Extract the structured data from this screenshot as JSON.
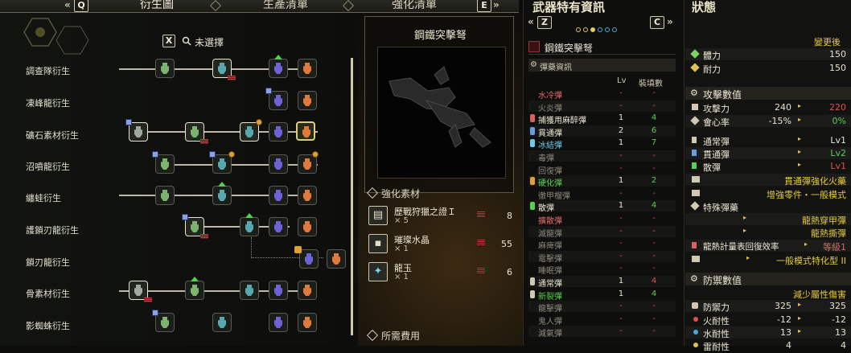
{
  "tabs": {
    "left_key": "Q",
    "right_key": "E",
    "items": [
      "衍生圖",
      "生產清單",
      "強化清單"
    ]
  },
  "filter": {
    "key": "X",
    "label": "未選擇"
  },
  "tree_rows": [
    "調查隊衍生",
    "凍峰龍衍生",
    "礦石素材衍生",
    "沼噴龍衍生",
    "纏蛙衍生",
    "護鎖刃龍衍生",
    "鎖刃龍衍生",
    "骨素材衍生",
    "影蜘蛛衍生"
  ],
  "preview": {
    "weapon_name": "鋼鐵突擊弩"
  },
  "materials": {
    "title": "強化素材",
    "items": [
      {
        "icon": "scroll-icon",
        "name": "歷戰狩獵之證Ｉ",
        "qty": "× 5",
        "owned": "8"
      },
      {
        "icon": "ore-icon",
        "name": "璀璨水晶",
        "qty": "× 1",
        "owned": "55"
      },
      {
        "icon": "gem-icon",
        "name": "龍玉",
        "qty": "× 1",
        "owned": "6"
      }
    ],
    "cost_title": "所需費用"
  },
  "spec": {
    "title": "武器特有資訊",
    "left_key": "Z",
    "right_key": "C",
    "weapon_name": "鋼鐵突擊弩",
    "ammo_header": "彈藥資訊",
    "col_lv": "Lv",
    "col_cap": "裝填數",
    "ammo": [
      {
        "name": "水冷彈",
        "lv": "-",
        "cap": "-",
        "color": "#e06a6a",
        "icon": ""
      },
      {
        "name": "火炎彈",
        "lv": "-",
        "cap": "-",
        "color": "#8c887a",
        "icon": ""
      },
      {
        "name": "捕獲用麻醉彈",
        "lv": "1",
        "cap": "4",
        "color": "#ebe6d2",
        "icon": "#d86060"
      },
      {
        "name": "貫通彈",
        "lv": "2",
        "cap": "6",
        "color": "#ebe6d2",
        "icon": "#6a9ae0"
      },
      {
        "name": "冰結彈",
        "lv": "1",
        "cap": "7",
        "color": "#6fc8e8",
        "icon": "#6fc8e8"
      },
      {
        "name": "毒彈",
        "lv": "-",
        "cap": "-",
        "color": "#8c887a",
        "icon": ""
      },
      {
        "name": "回復彈",
        "lv": "-",
        "cap": "-",
        "color": "#8c887a",
        "icon": ""
      },
      {
        "name": "硬化彈",
        "lv": "1",
        "cap": "2",
        "color": "#58d050",
        "icon": "#e0a032"
      },
      {
        "name": "徹甲榴彈",
        "lv": "-",
        "cap": "-",
        "color": "#8c887a",
        "icon": ""
      },
      {
        "name": "散彈",
        "lv": "1",
        "cap": "4",
        "color": "#ebe6d2",
        "icon": "#58d050"
      },
      {
        "name": "擴散彈",
        "lv": "-",
        "cap": "-",
        "color": "#e06a6a",
        "icon": ""
      },
      {
        "name": "滅龍彈",
        "lv": "-",
        "cap": "-",
        "color": "#8c887a",
        "icon": ""
      },
      {
        "name": "麻痺彈",
        "lv": "-",
        "cap": "-",
        "color": "#8c887a",
        "icon": ""
      },
      {
        "name": "電擊彈",
        "lv": "-",
        "cap": "-",
        "color": "#8c887a",
        "icon": ""
      },
      {
        "name": "睡眠彈",
        "lv": "-",
        "cap": "-",
        "color": "#8c887a",
        "icon": ""
      },
      {
        "name": "通常彈",
        "lv": "1",
        "cap": "4",
        "color": "#ebe6d2",
        "icon": "#cfc9b2"
      },
      {
        "name": "新裂彈",
        "lv": "1",
        "cap": "4",
        "color": "#58d050",
        "icon": "#cfc9b2"
      },
      {
        "name": "龍擊彈",
        "lv": "-",
        "cap": "-",
        "color": "#8c887a",
        "icon": ""
      },
      {
        "name": "鬼人彈",
        "lv": "-",
        "cap": "-",
        "color": "#8c887a",
        "icon": ""
      },
      {
        "name": "減氣彈",
        "lv": "-",
        "cap": "-",
        "color": "#8c887a",
        "icon": ""
      }
    ]
  },
  "status": {
    "title": "狀態",
    "after_label": "變更後",
    "basic": [
      {
        "label": "體力",
        "value": "150"
      },
      {
        "label": "耐力",
        "value": "150"
      }
    ],
    "attack_header": "攻擊數值",
    "attack": {
      "label": "攻擊力",
      "before": "240",
      "after": "220"
    },
    "affinity": {
      "label": "會心率",
      "before": "-15%",
      "after": "0%"
    },
    "ammo_lv": [
      {
        "label": "通常彈",
        "value": "Lv1",
        "color": "#ebe6d2"
      },
      {
        "label": "貫通彈",
        "value": "Lv2",
        "color": "#58d050"
      },
      {
        "label": "散彈",
        "value": "Lv1",
        "color": "#e05050"
      }
    ],
    "mods": [
      "貫通彈強化火藥",
      "增強零件・一般模式"
    ],
    "special_header": "特殊彈藥",
    "special": [
      "龍熱穿甲彈",
      "龍熱撕彈"
    ],
    "gauge": {
      "label": "龍熱計量表回復效率",
      "value": "等級1"
    },
    "mode": "一般模式特化型 II",
    "defense_header": "防禦數值",
    "defense_note": "減少屬性傷害",
    "defense": {
      "label": "防禦力",
      "before": "325",
      "after": "325"
    },
    "fire": {
      "label": "火耐性",
      "before": "-12",
      "after": "-12"
    },
    "water": {
      "label": "水耐性",
      "before": "13",
      "after": "13"
    },
    "thunder": {
      "label": "雷耐性",
      "before": "4",
      "after": "4"
    }
  }
}
